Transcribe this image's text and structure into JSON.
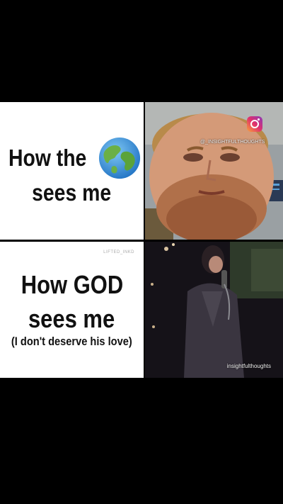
{
  "top_left": {
    "line1": "How the",
    "line2": "sees me",
    "globe_icon": "earth-globe-icon"
  },
  "bottom_left": {
    "corner_mark": "LIFTED_INKD",
    "line1": "How GOD",
    "line2": "sees me",
    "line3": "(I don't deserve his love)"
  },
  "top_right": {
    "watermark": "@_INSIGHTFULTHOUGHTS",
    "icon": "instagram-icon"
  },
  "bottom_right": {
    "watermark": "insightfulthoughts"
  }
}
